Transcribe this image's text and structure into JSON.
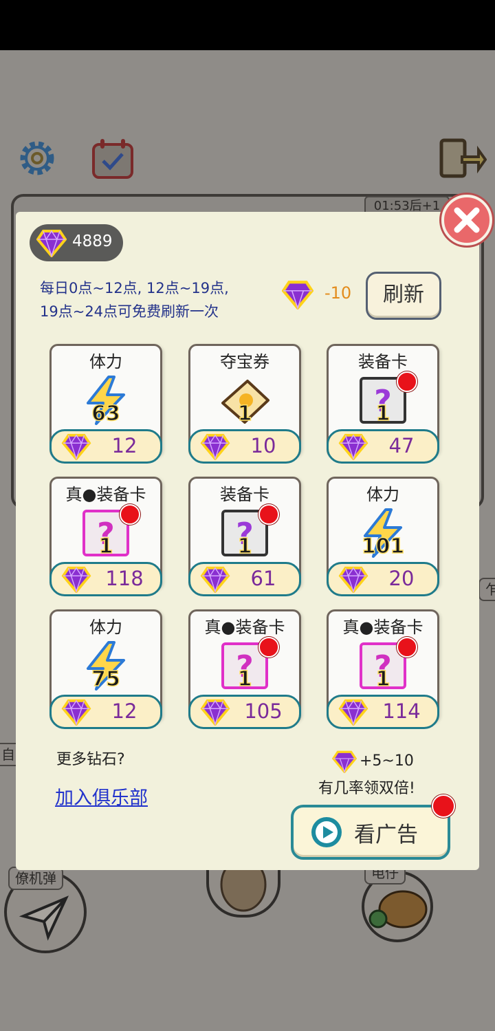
{
  "background": {
    "timer": "01:53后+1",
    "tag_left": "僚机弹",
    "tag_right": "电仔",
    "tag_edge_left": "自",
    "tag_edge_right": "乍"
  },
  "wallet": {
    "diamonds": "4889"
  },
  "refresh": {
    "info_line1": "每日0点~12点, 12点~19点,",
    "info_line2": "19点~24点可免费刷新一次",
    "cost": "-10",
    "button_label": "刷新"
  },
  "items": [
    {
      "name": "体力",
      "qty": "63",
      "price": "12",
      "type": "energy",
      "badge": false
    },
    {
      "name": "夺宝券",
      "qty": "1",
      "price": "10",
      "type": "ticket",
      "badge": false
    },
    {
      "name": "装备卡",
      "qty": "1",
      "price": "47",
      "type": "card-gray",
      "badge": true
    },
    {
      "name": "真●装备卡",
      "qty": "1",
      "price": "118",
      "type": "card-pink",
      "badge": true
    },
    {
      "name": "装备卡",
      "qty": "1",
      "price": "61",
      "type": "card-gray",
      "badge": true
    },
    {
      "name": "体力",
      "qty": "101",
      "price": "20",
      "type": "energy",
      "badge": false
    },
    {
      "name": "体力",
      "qty": "75",
      "price": "12",
      "type": "energy",
      "badge": false
    },
    {
      "name": "真●装备卡",
      "qty": "1",
      "price": "105",
      "type": "card-pink",
      "badge": true
    },
    {
      "name": "真●装备卡",
      "qty": "1",
      "price": "114",
      "type": "card-pink",
      "badge": true
    }
  ],
  "footer": {
    "more_diamonds": "更多钻石?",
    "join_club": "加入俱乐部",
    "ad_reward": "+5~10",
    "ad_double": "有几率领双倍!",
    "ad_button": "看广告"
  },
  "colors": {
    "accent": "#1f7b8a",
    "gem": "#7a2a9a",
    "badge": "#e8121a",
    "panel": "#f2f1dc"
  }
}
